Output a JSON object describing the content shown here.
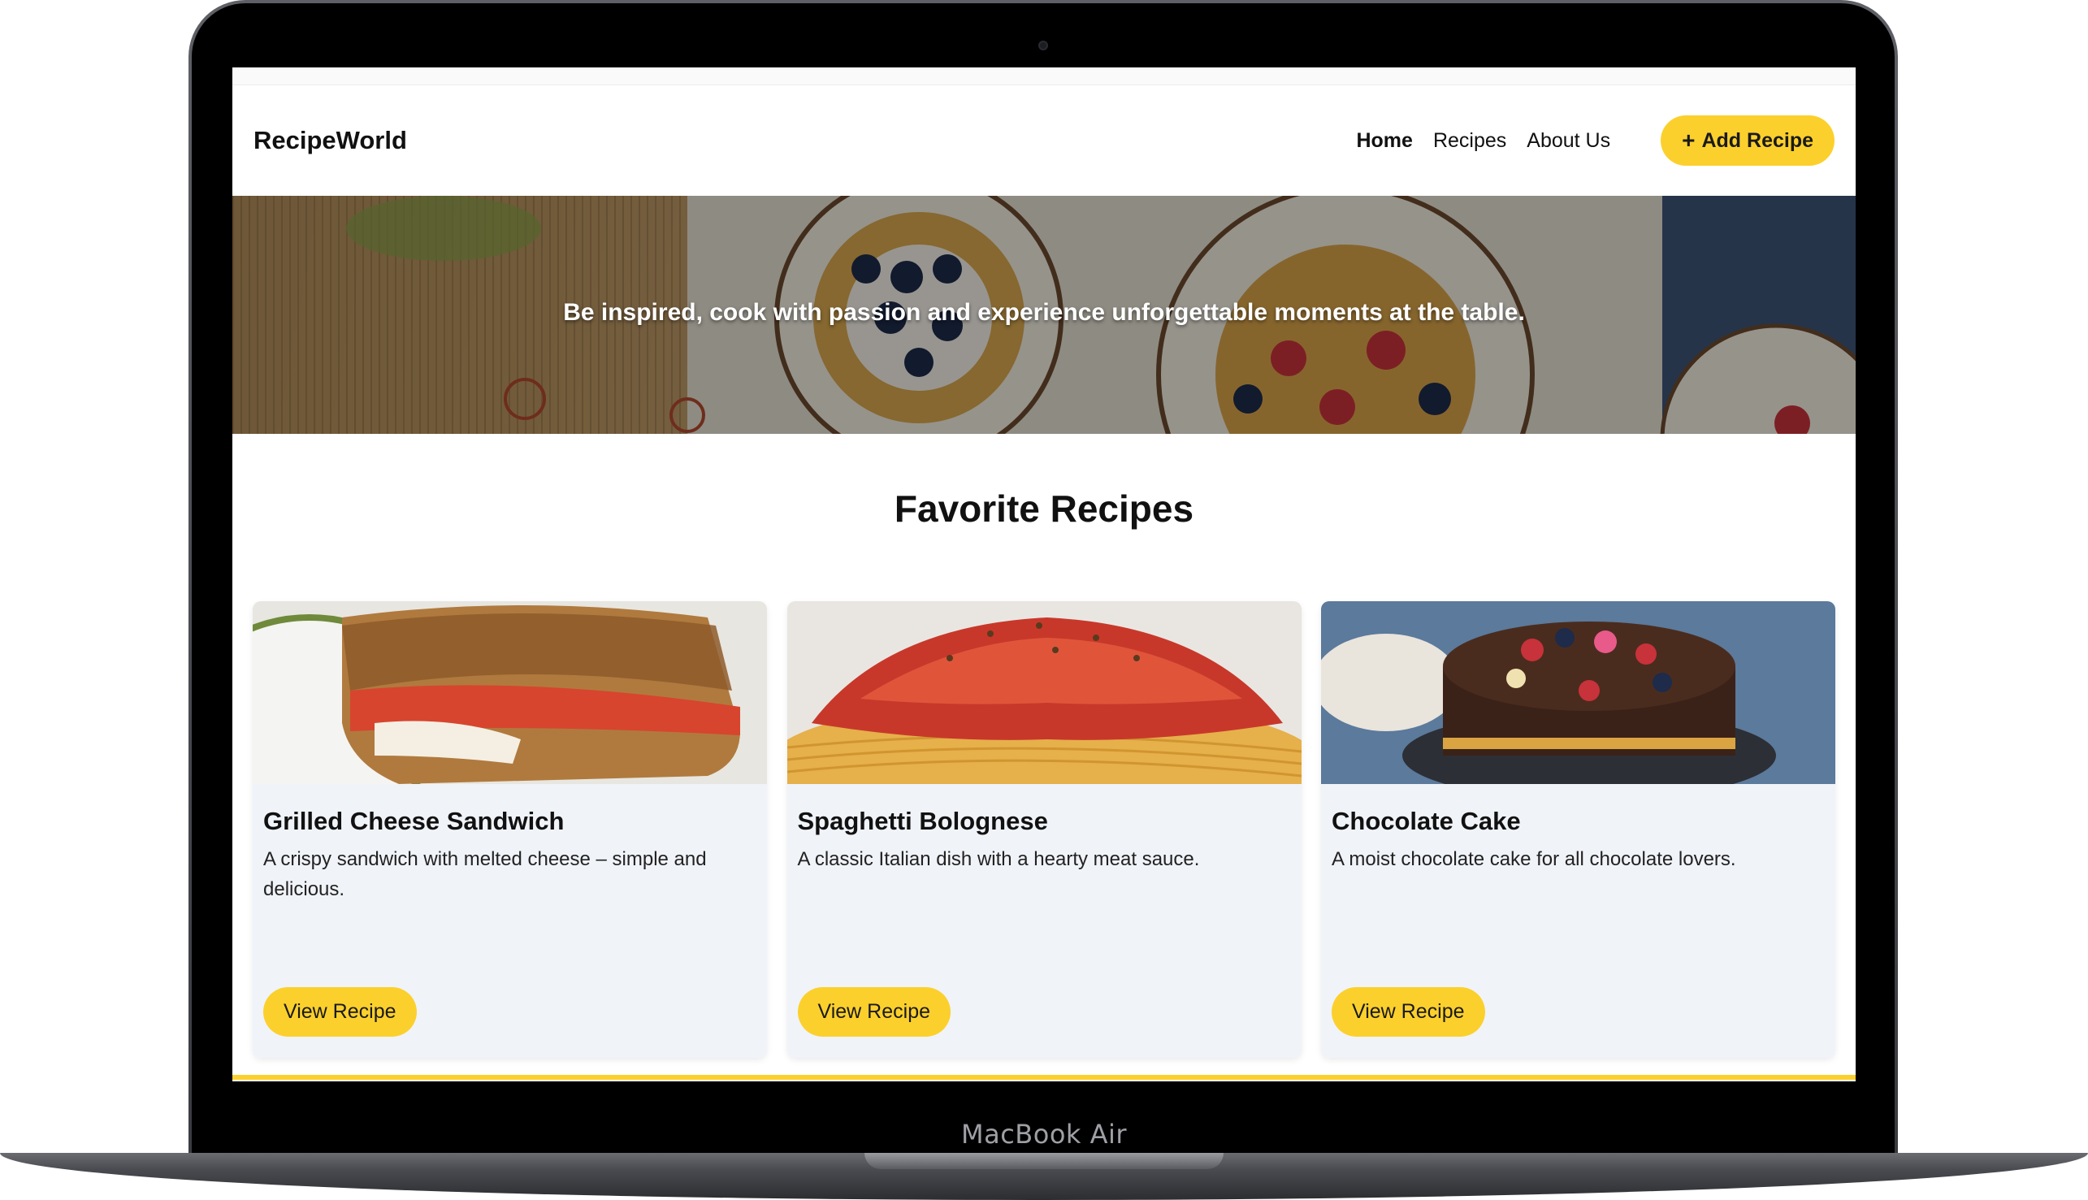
{
  "device": {
    "label": "MacBook Air"
  },
  "site": {
    "logo": "RecipeWorld",
    "nav": {
      "items": [
        {
          "label": "Home",
          "active": true
        },
        {
          "label": "Recipes",
          "active": false
        },
        {
          "label": "About Us",
          "active": false
        }
      ],
      "add_button": {
        "icon": "plus-icon",
        "icon_glyph": "+",
        "label": "Add Recipe"
      }
    },
    "hero": {
      "tagline": "Be inspired, cook with passion and experience unforgettable moments at the table."
    },
    "section_title": "Favorite Recipes",
    "recipes": [
      {
        "title": "Grilled Cheese Sandwich",
        "description": "A crispy sandwich with melted cheese – simple and delicious.",
        "button": "View Recipe"
      },
      {
        "title": "Spaghetti Bolognese",
        "description": "A classic Italian dish with a hearty meat sauce.",
        "button": "View Recipe"
      },
      {
        "title": "Chocolate Cake",
        "description": "A moist chocolate cake for all chocolate lovers.",
        "button": "View Recipe"
      }
    ]
  },
  "colors": {
    "accent": "#fcd02c",
    "card_background": "#f0f3f8",
    "text": "#111111"
  }
}
